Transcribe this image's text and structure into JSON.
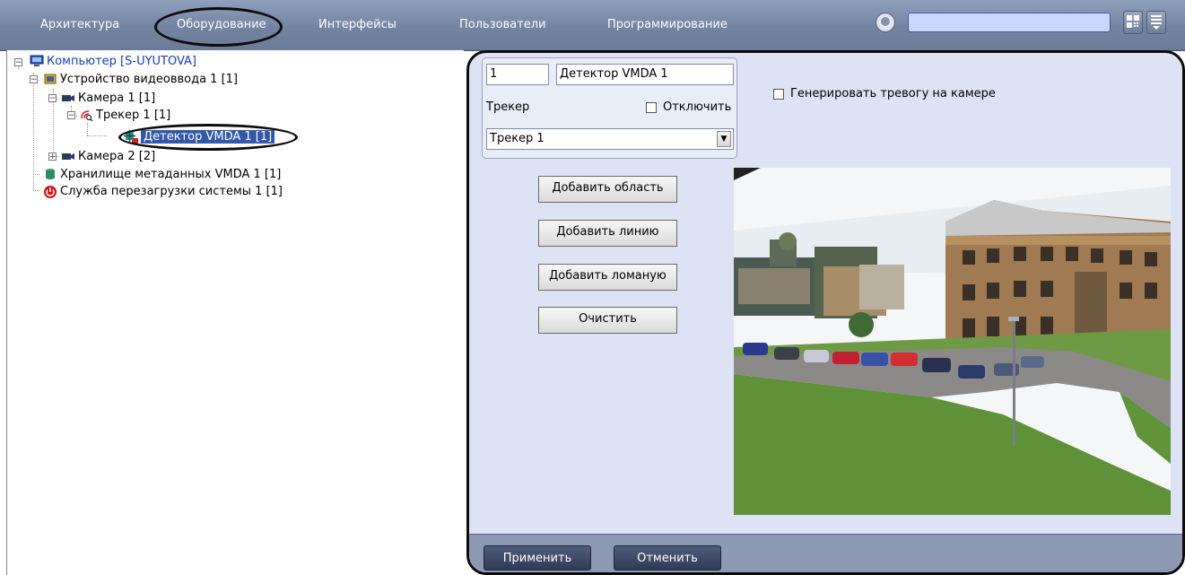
{
  "menu": {
    "items": [
      "Архитектура",
      "Оборудование",
      "Интерфейсы",
      "Пользователи",
      "Программирование"
    ],
    "search_value": ""
  },
  "tree": {
    "computer": "Компьютер [S-UYUTOVA]",
    "video_device": "Устройство видеоввода 1 [1]",
    "camera1": "Камера 1 [1]",
    "tracker": "Трекер 1 [1]",
    "detector": "Детектор VMDA 1 [1]",
    "camera2": "Камера 2 [2]",
    "storage": "Хранилище метаданных VMDA 1 [1]",
    "reboot_service": "Служба перезагрузки системы 1 [1]"
  },
  "settings": {
    "id_value": "1",
    "name_value": "Детектор VMDA 1",
    "tracker_label": "Трекер",
    "disable_label": "Отключить",
    "tracker_select": "Трекер 1",
    "generate_alarm_label": "Генерировать тревогу на камере",
    "add_area": "Добавить область",
    "add_line": "Добавить линию",
    "add_polyline": "Добавить ломаную",
    "clear": "Очистить"
  },
  "footer": {
    "apply": "Применить",
    "cancel": "Отменить"
  },
  "colors": {
    "menubar": "#7d8eab",
    "panel_bg": "#dde2f4",
    "selection": "#3358a8",
    "search_box": "#c9d6ff"
  },
  "icons": [
    "computer-icon",
    "video-device-icon",
    "camera-icon",
    "tracker-icon",
    "detector-icon",
    "database-icon",
    "power-icon",
    "layout-icon",
    "list-icon",
    "globe-icon"
  ]
}
